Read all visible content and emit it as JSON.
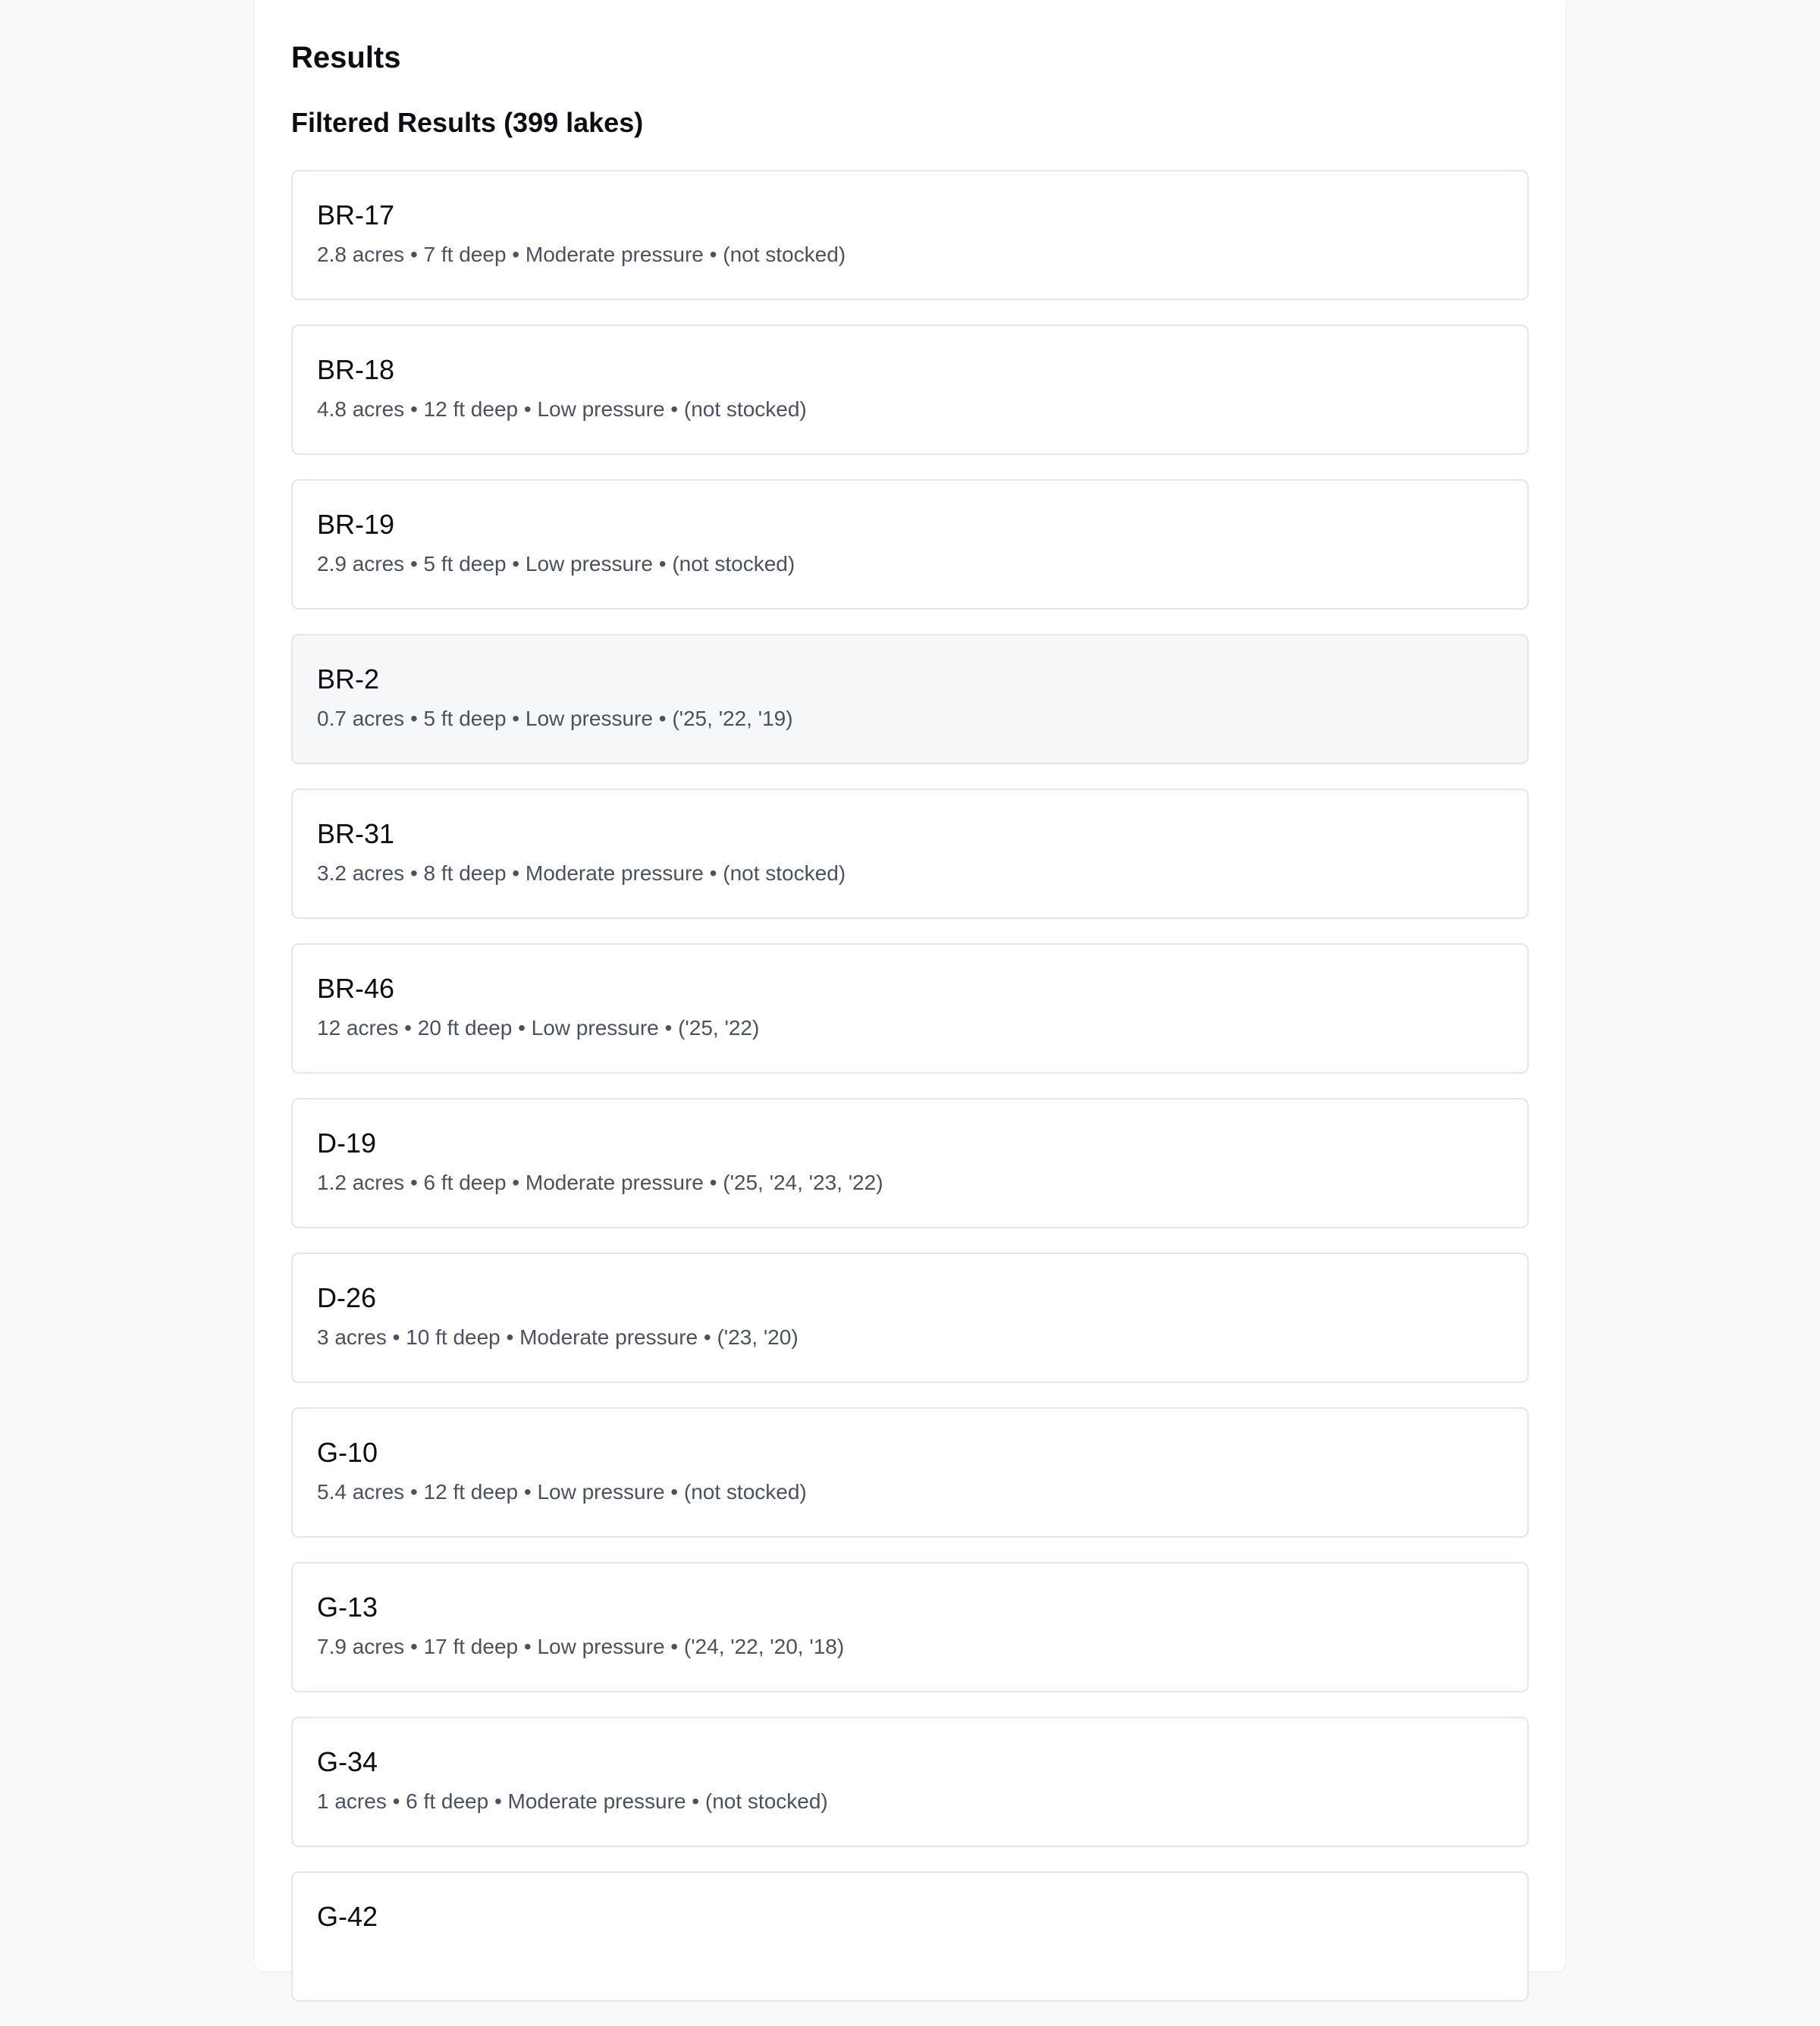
{
  "results": {
    "heading": "Results",
    "filtered_heading": "Filtered Results (399 lakes)",
    "lakes": [
      {
        "name": "BR-17",
        "details": "2.8 acres • 7 ft deep • Moderate pressure • (not stocked)"
      },
      {
        "name": "BR-18",
        "details": "4.8 acres • 12 ft deep • Low pressure • (not stocked)"
      },
      {
        "name": "BR-19",
        "details": "2.9 acres • 5 ft deep • Low pressure • (not stocked)"
      },
      {
        "name": "BR-2",
        "details": "0.7 acres • 5 ft deep • Low pressure • ('25, '22, '19)"
      },
      {
        "name": "BR-31",
        "details": "3.2 acres • 8 ft deep • Moderate pressure • (not stocked)"
      },
      {
        "name": "BR-46",
        "details": "12 acres • 20 ft deep • Low pressure • ('25, '22)"
      },
      {
        "name": "D-19",
        "details": "1.2 acres • 6 ft deep • Moderate pressure • ('25, '24, '23, '22)"
      },
      {
        "name": "D-26",
        "details": "3 acres • 10 ft deep • Moderate pressure • ('23, '20)"
      },
      {
        "name": "G-10",
        "details": "5.4 acres • 12 ft deep • Low pressure • (not stocked)"
      },
      {
        "name": "G-13",
        "details": "7.9 acres • 17 ft deep • Low pressure • ('24, '22, '20, '18)"
      },
      {
        "name": "G-34",
        "details": "1 acres • 6 ft deep • Moderate pressure • (not stocked)"
      },
      {
        "name": "G-42",
        "details": ""
      }
    ]
  }
}
